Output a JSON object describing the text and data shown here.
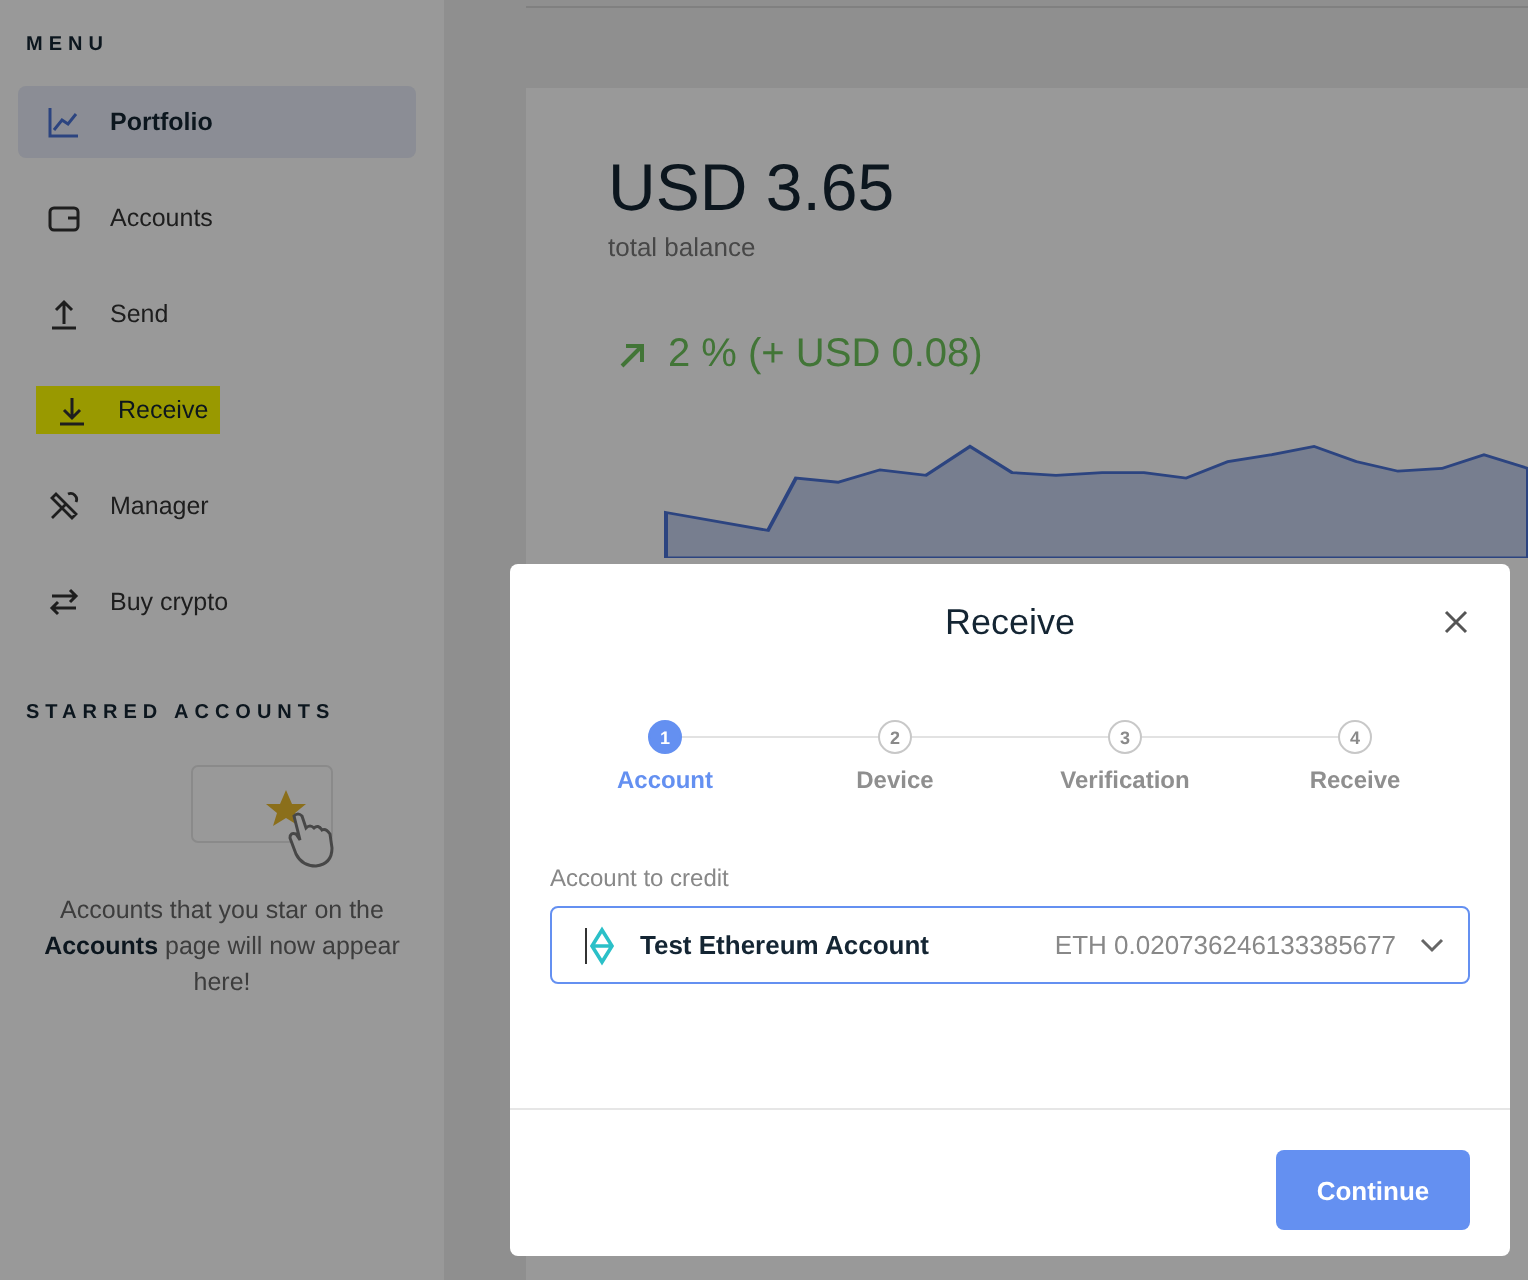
{
  "sidebar": {
    "menu_title": "MENU",
    "items": [
      {
        "label": "Portfolio",
        "selected": true,
        "highlighted": false
      },
      {
        "label": "Accounts",
        "selected": false,
        "highlighted": false
      },
      {
        "label": "Send",
        "selected": false,
        "highlighted": false
      },
      {
        "label": "Receive",
        "selected": false,
        "highlighted": true
      },
      {
        "label": "Manager",
        "selected": false,
        "highlighted": false
      },
      {
        "label": "Buy crypto",
        "selected": false,
        "highlighted": false
      }
    ],
    "starred_title": "STARRED ACCOUNTS",
    "starred_empty_text": "Accounts that you star on the **Accounts** page will now appear here!"
  },
  "balance": {
    "amount": "USD 3.65",
    "caption": "total balance",
    "change": "2 % (+ USD 0.08)"
  },
  "modal": {
    "title": "Receive",
    "steps": [
      {
        "number": "1",
        "label": "Account",
        "selected": true
      },
      {
        "number": "2",
        "label": "Device",
        "selected": false
      },
      {
        "number": "3",
        "label": "Verification",
        "selected": false
      },
      {
        "number": "4",
        "label": "Receive",
        "selected": false
      }
    ],
    "field_label": "Account to credit",
    "account": {
      "name": "Test Ethereum Account",
      "balance": "ETH 0.020736246133385677"
    },
    "continue_button": "Continue"
  }
}
